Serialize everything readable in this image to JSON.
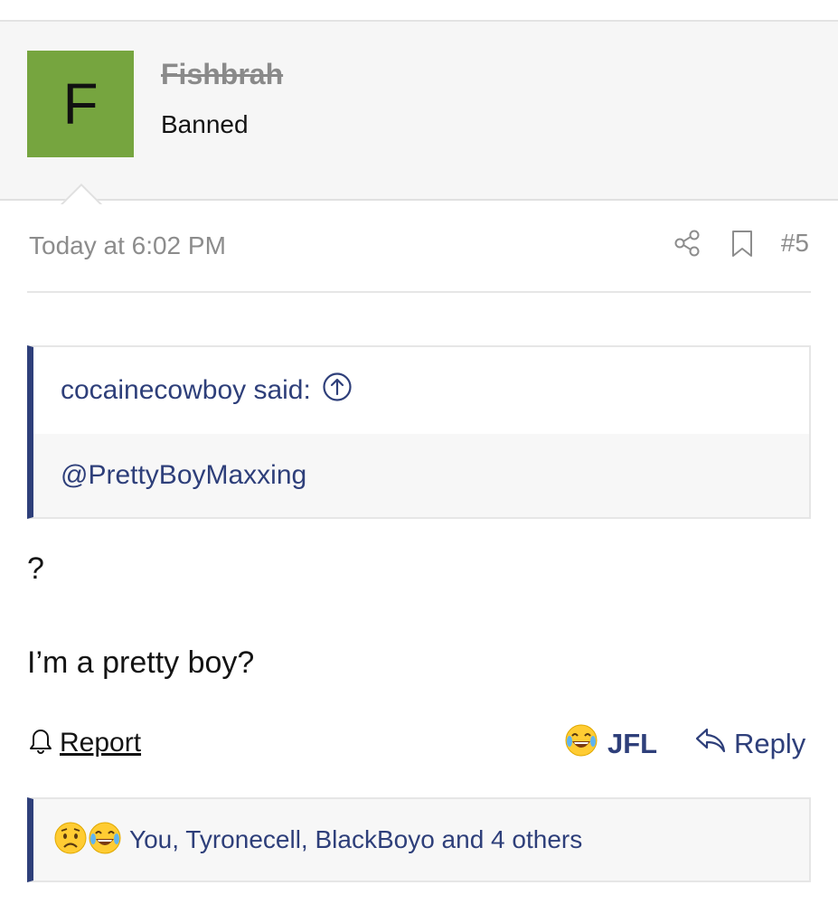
{
  "user": {
    "avatar_letter": "F",
    "avatar_color": "#76a53f",
    "name": "Fishbrah",
    "title": "Banned"
  },
  "post": {
    "date": "Today at 6:02 PM",
    "number": "#5",
    "share_icon": "share-icon",
    "bookmark_icon": "bookmark-icon"
  },
  "quote": {
    "author_line": "cocainecowboy said:",
    "jump_icon": "arrow-up-circle-icon",
    "body": "@PrettyBoyMaxxing"
  },
  "message": {
    "lines": [
      "?",
      "I’m a pretty boy?"
    ]
  },
  "actions": {
    "report": "Report",
    "react_label": "JFL",
    "react_icon": "laughing-crying-emoji-icon",
    "reply": "Reply"
  },
  "reactions": {
    "icons": [
      "sad-emoji-icon",
      "laughing-crying-emoji-icon"
    ],
    "summary": "You, Tyronecell, BlackBoyo and 4 others"
  },
  "colors": {
    "accent": "#2e3f7a",
    "avatar": "#76a53f",
    "muted_text": "#8c8c8c"
  }
}
